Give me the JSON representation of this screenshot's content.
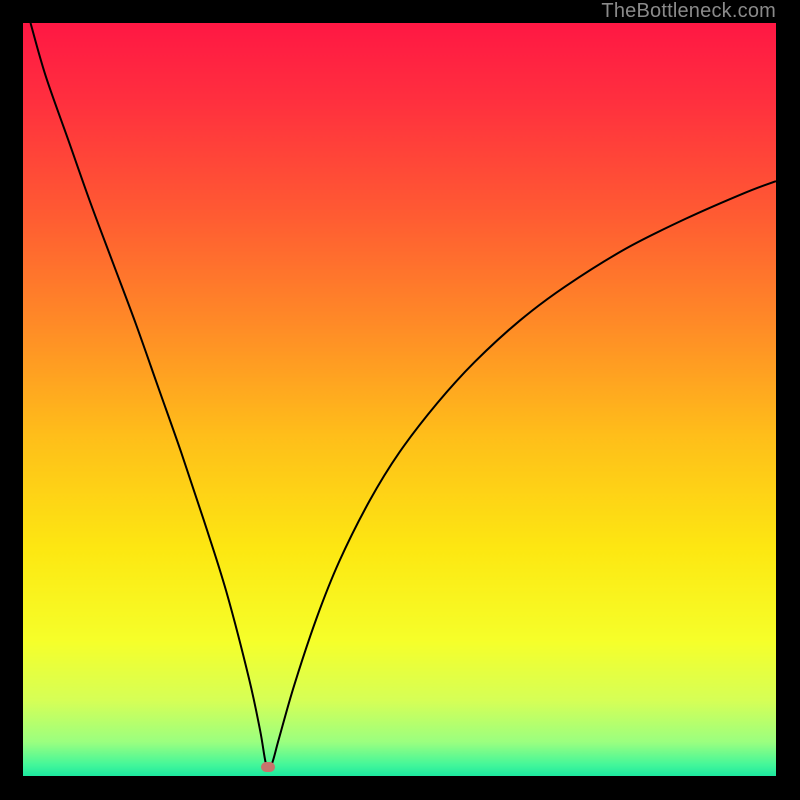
{
  "watermark": "TheBottleneck.com",
  "chart_data": {
    "type": "line",
    "title": "",
    "xlabel": "",
    "ylabel": "",
    "xlim": [
      0,
      100
    ],
    "ylim": [
      0,
      100
    ],
    "grid": false,
    "legend": false,
    "annotations": [],
    "background": {
      "type": "vertical-gradient",
      "stops": [
        {
          "pos": 0.0,
          "color": "#ff1844"
        },
        {
          "pos": 0.1,
          "color": "#ff2f3f"
        },
        {
          "pos": 0.25,
          "color": "#ff5a33"
        },
        {
          "pos": 0.4,
          "color": "#ff8b27"
        },
        {
          "pos": 0.55,
          "color": "#ffbf1a"
        },
        {
          "pos": 0.7,
          "color": "#fde812"
        },
        {
          "pos": 0.82,
          "color": "#f6ff2a"
        },
        {
          "pos": 0.9,
          "color": "#d6ff57"
        },
        {
          "pos": 0.955,
          "color": "#9bff80"
        },
        {
          "pos": 0.985,
          "color": "#44f79a"
        },
        {
          "pos": 1.0,
          "color": "#1de9a0"
        }
      ]
    },
    "series": [
      {
        "name": "bottleneck-curve",
        "color": "#000000",
        "width": 2,
        "x": [
          1.0,
          3,
          6,
          9,
          12,
          15,
          18,
          21,
          24,
          27,
          30,
          31.5,
          32.3,
          33,
          34,
          36,
          39,
          42,
          46,
          50,
          55,
          60,
          66,
          72,
          80,
          88,
          96,
          100
        ],
        "values": [
          100,
          93,
          84.5,
          76,
          68,
          60,
          51.5,
          43,
          34,
          24.5,
          13,
          6,
          1.5,
          1.5,
          5,
          12,
          21,
          28.5,
          36.5,
          43,
          49.5,
          55,
          60.5,
          65,
          70,
          74,
          77.5,
          79
        ]
      }
    ],
    "marker": {
      "name": "optimal-point",
      "x": 32.6,
      "y": 1.2,
      "color": "#c8736c"
    }
  }
}
